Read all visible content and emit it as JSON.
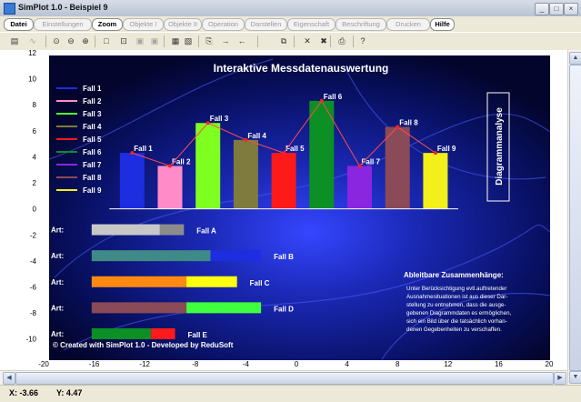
{
  "window": {
    "title": "SimPlot 1.0 - Beispiel 9",
    "buttons": [
      "_",
      "□",
      "×"
    ]
  },
  "menu": [
    {
      "label": "Datei",
      "state": "on"
    },
    {
      "label": "Einstellungen",
      "state": "dim"
    },
    {
      "label": "Zoom",
      "state": "on"
    },
    {
      "label": "Objekte I",
      "state": "dim"
    },
    {
      "label": "Objekte II",
      "state": "dim"
    },
    {
      "label": "Operation",
      "state": "dim"
    },
    {
      "label": "Darstellen",
      "state": "dim"
    },
    {
      "label": "Eigenschaft",
      "state": "dim"
    },
    {
      "label": "Beschriftung",
      "state": "dim"
    },
    {
      "label": "Drucken",
      "state": "dim"
    },
    {
      "label": "Hilfe",
      "state": "on"
    }
  ],
  "toolbar": [
    {
      "icon": "calculator-icon",
      "glyph": "▤",
      "dim": false
    },
    {
      "icon": "curve-icon",
      "glyph": "∿",
      "dim": true
    },
    {
      "icon": "zoom-icon",
      "glyph": "⊙",
      "dim": false
    },
    {
      "icon": "zoom-out-icon",
      "glyph": "⊖",
      "dim": false
    },
    {
      "icon": "zoom-in-icon",
      "glyph": "⊕",
      "dim": false
    },
    {
      "icon": "rectangle-icon",
      "glyph": "□",
      "dim": false
    },
    {
      "icon": "fit-icon",
      "glyph": "⊡",
      "dim": false
    },
    {
      "icon": "frame-icon",
      "glyph": "▣",
      "dim": true
    },
    {
      "icon": "frame-alt-icon",
      "glyph": "▣",
      "dim": true
    },
    {
      "icon": "grid-icon",
      "glyph": "▦",
      "dim": false
    },
    {
      "icon": "image-icon",
      "glyph": "▧",
      "dim": false
    },
    {
      "icon": "paste-icon",
      "glyph": "⎘",
      "dim": false
    },
    {
      "icon": "arrow-right-icon",
      "glyph": "→",
      "dim": false
    },
    {
      "icon": "arrow-left-icon",
      "glyph": "←",
      "dim": false
    },
    {
      "icon": "copy-icon",
      "glyph": "⧉",
      "dim": false
    },
    {
      "icon": "delete-icon",
      "glyph": "✕",
      "dim": false
    },
    {
      "icon": "delete-all-icon",
      "glyph": "✖",
      "dim": false
    },
    {
      "icon": "print-icon",
      "glyph": "⎙",
      "dim": false
    },
    {
      "icon": "help-icon",
      "glyph": "?",
      "dim": false
    }
  ],
  "colors": {
    "panel": "#06083a",
    "accent": "#2a36c8",
    "frame": "#ffffff"
  },
  "status": {
    "x": "X: -3.66",
    "y": "Y: 4.47"
  },
  "chart_data": {
    "type": "bar",
    "title": "Interaktive Messdatenauswertung",
    "xlim": [
      -20,
      20
    ],
    "ylim": [
      -11,
      12
    ],
    "xticks": [
      "-20",
      "-16",
      "-12",
      "-8",
      "-4",
      "0",
      "4",
      "8",
      "12",
      "16",
      "20"
    ],
    "yticks": [
      "12",
      "10",
      "8",
      "6",
      "4",
      "2",
      "0",
      "-2",
      "-4",
      "-6",
      "-8",
      "-10"
    ],
    "legend": [
      {
        "label": "Fall 1",
        "color": "#1d2de0"
      },
      {
        "label": "Fall 2",
        "color": "#ff8cc8"
      },
      {
        "label": "Fall 3",
        "color": "#55ff3b"
      },
      {
        "label": "Fall 4",
        "color": "#7f7a3e"
      },
      {
        "label": "Fall 5",
        "color": "#ff1a1a"
      },
      {
        "label": "Fall 6",
        "color": "#0c8f24"
      },
      {
        "label": "Fall 7",
        "color": "#8a25e0"
      },
      {
        "label": "Fall 8",
        "color": "#8a4a58"
      },
      {
        "label": "Fall 9",
        "color": "#f2ef1a"
      }
    ],
    "bars": [
      {
        "label": "Fall 1",
        "x": -13,
        "value": 4.3,
        "color": "#1d2de0"
      },
      {
        "label": "Fall 2",
        "x": -10,
        "value": 3.3,
        "color": "#ff8cc8"
      },
      {
        "label": "Fall 3",
        "x": -7,
        "value": 6.6,
        "color": "#7fff20"
      },
      {
        "label": "Fall 4",
        "x": -4,
        "value": 5.3,
        "color": "#7f7a3e"
      },
      {
        "label": "Fall 5",
        "x": -1,
        "value": 4.3,
        "color": "#ff1a1a"
      },
      {
        "label": "Fall 6",
        "x": 2,
        "value": 8.3,
        "color": "#0c8f24"
      },
      {
        "label": "Fall 7",
        "x": 5,
        "value": 3.3,
        "color": "#8a25e0"
      },
      {
        "label": "Fall 8",
        "x": 8,
        "value": 6.3,
        "color": "#8a4a58"
      },
      {
        "label": "Fall 9",
        "x": 11,
        "value": 4.3,
        "color": "#f2ef1a"
      }
    ],
    "art_label": "Art:",
    "hbars": [
      {
        "label": "Fall A",
        "y": -1.6,
        "segments": [
          {
            "from": -16.2,
            "to": -10.8,
            "color": "#c8c8c8"
          },
          {
            "from": -10.8,
            "to": -8.9,
            "color": "#8c8c8c"
          }
        ]
      },
      {
        "label": "Fall B",
        "y": -3.6,
        "segments": [
          {
            "from": -16.2,
            "to": -6.8,
            "color": "#3f8a86"
          },
          {
            "from": -6.8,
            "to": -2.8,
            "color": "#1d2de0"
          }
        ]
      },
      {
        "label": "Fall C",
        "y": -5.6,
        "segments": [
          {
            "from": -16.2,
            "to": -8.7,
            "color": "#ff8a12"
          },
          {
            "from": -8.7,
            "to": -4.7,
            "color": "#ffff10"
          }
        ]
      },
      {
        "label": "Fall D",
        "y": -7.6,
        "segments": [
          {
            "from": -16.2,
            "to": -8.7,
            "color": "#8a4a58"
          },
          {
            "from": -8.7,
            "to": -2.8,
            "color": "#3fff3f"
          }
        ]
      },
      {
        "label": "Fall E",
        "y": -9.6,
        "segments": [
          {
            "from": -16.2,
            "to": -11.5,
            "color": "#0c8f24"
          },
          {
            "from": -11.5,
            "to": -9.6,
            "color": "#ff1a1a"
          }
        ]
      }
    ],
    "vertical_label": "Diagrammanalyse",
    "info_title": "Ableitbare Zusammenhänge:",
    "info_lines": [
      "Unter Berücksichtigung evtl.auftretender",
      "Ausnahmesituationen ist aus dieser Dar-",
      "stellung zu entnehmen, dass die ausge-",
      "gebenen Diagrammdaten es ermöglichen,",
      "sich ein Bild über die tatsächlich vorhan-",
      "denen Gegebenheiten zu verschaffen."
    ],
    "footer": "© Created with SimPlot 1.0 - Developed by ReduSoft"
  }
}
